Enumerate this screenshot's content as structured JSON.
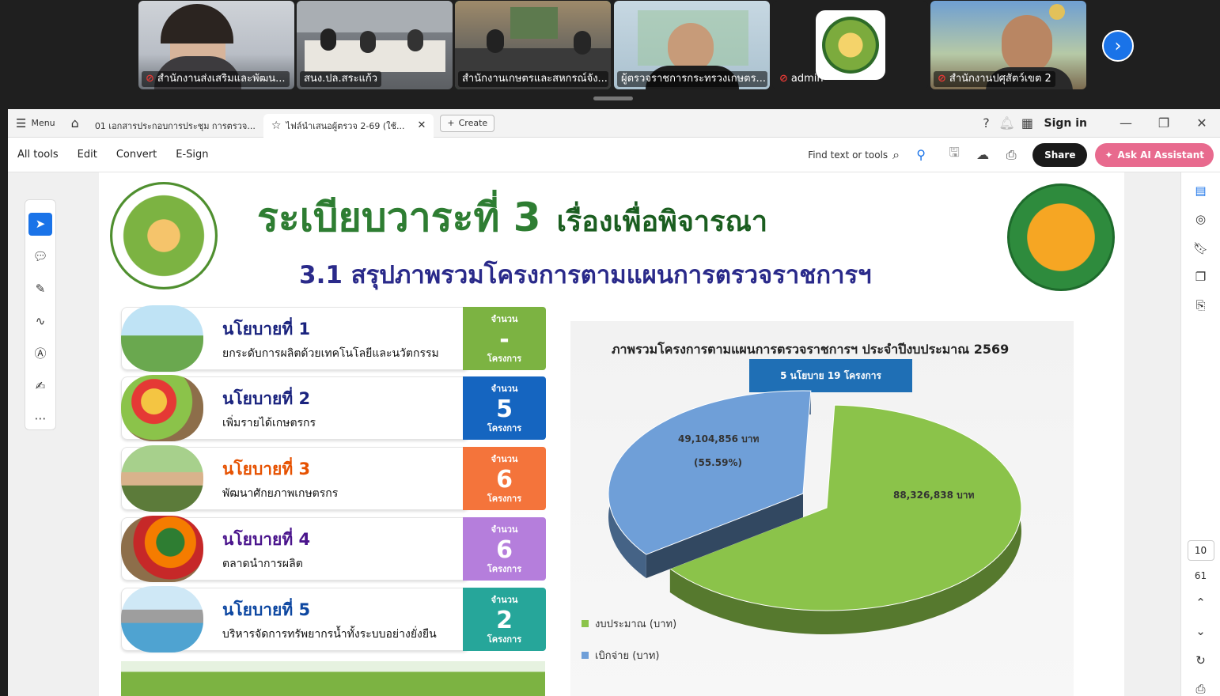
{
  "meeting": {
    "tiles": [
      {
        "name": "สำนักงานส่งเสริมและพัฒน...",
        "muted": true
      },
      {
        "name": "สนง.ปล.สระแก้ว",
        "muted": false
      },
      {
        "name": "สำนักงานเกษตรและสหกรณ์จัง...",
        "muted": false,
        "active": true
      },
      {
        "name": "ผู้ตรวจราชการกระทรวงเกษตร...",
        "muted": false
      },
      {
        "name": "admin",
        "muted": true
      },
      {
        "name": "สำนักงานปศุสัตว์เขต 2",
        "muted": true
      }
    ]
  },
  "acrobat": {
    "menu_label": "Menu",
    "tabs": [
      {
        "label": "01 เอกสารประกอบการประชุม การตรวจ..."
      },
      {
        "label": "ไฟล์นำเสนอผู้ตรวจ 2-69 (ใช้..."
      }
    ],
    "create_label": "Create",
    "sign_in_label": "Sign in",
    "menus": [
      "All tools",
      "Edit",
      "Convert",
      "E-Sign"
    ],
    "find_placeholder": "Find text or tools",
    "share_label": "Share",
    "ai_label": "Ask AI Assistant",
    "page_current": "10",
    "page_total": "61"
  },
  "slide": {
    "title_main": "ระเบียบวาระที่ 3",
    "title_sub": "เรื่องเพื่อพิจารณา",
    "subtitle": "3.1 สรุปภาพรวมโครงการตามแผนการตรวจราชการฯ",
    "count_label": "จำนวน",
    "count_unit": "โครงการ",
    "policies": [
      {
        "name": "นโยบายที่ 1",
        "desc": "ยกระดับการผลิตด้วยเทคโนโลยีและนวัตกรรม",
        "count": "-",
        "color": "#7cb342",
        "name_color": "#1a237e"
      },
      {
        "name": "นโยบายที่ 2",
        "desc": "เพิ่มรายได้เกษตรกร",
        "count": "5",
        "color": "#1565c0",
        "name_color": "#1a237e"
      },
      {
        "name": "นโยบายที่ 3",
        "desc": "พัฒนาศักยภาพเกษตรกร",
        "count": "6",
        "color": "#f4743b",
        "name_color": "#e65100"
      },
      {
        "name": "นโยบายที่ 4",
        "desc": "ตลาดนำการผลิต",
        "count": "6",
        "color": "#b57edc",
        "name_color": "#4a148c"
      },
      {
        "name": "นโยบายที่ 5",
        "desc": "บริหารจัดการทรัพยากรน้ำทั้งระบบอย่างยั่งยืน",
        "count": "2",
        "color": "#26a69a",
        "name_color": "#0d47a1"
      }
    ]
  },
  "chart_data": {
    "type": "pie",
    "title": "ภาพรวมโครงการตามแผนการตรวจราชการฯ ประจำปีงบประมาณ 2569",
    "badge": "5 นโยบาย 19 โครงการ",
    "slices": [
      {
        "name": "งบประมาณ (บาท)",
        "value": 88326838,
        "label": "88,326,838  บาท",
        "color": "#8bc34a"
      },
      {
        "name": "เบิกจ่าย (บาท)",
        "value": 49104856,
        "label": "49,104,856  บาท",
        "percent_label": "(55.59%)",
        "color": "#6f9fd8"
      }
    ],
    "legend_position": "bottom-left"
  }
}
